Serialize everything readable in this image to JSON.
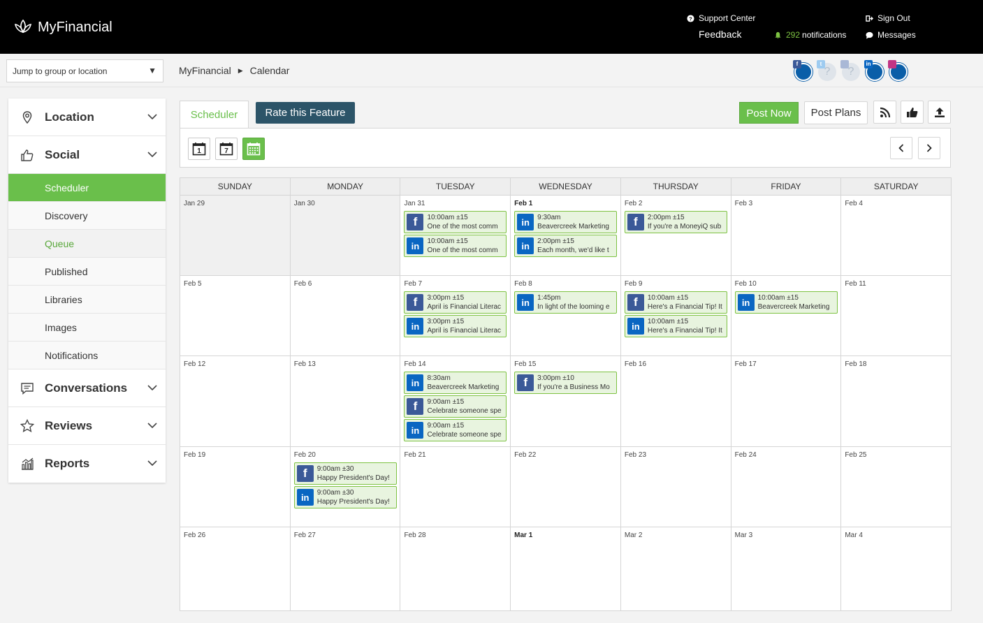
{
  "header": {
    "brand": "MyFinancial",
    "support": "Support Center",
    "feedback": "Feedback",
    "notif_count": "292",
    "notif_label": "notifications",
    "sign_out": "Sign Out",
    "messages": "Messages"
  },
  "subbar": {
    "jump_placeholder": "Jump to group or location",
    "crumb_root": "MyFinancial",
    "crumb_current": "Calendar"
  },
  "sidebar": {
    "location": "Location",
    "social": "Social",
    "social_items": [
      "Scheduler",
      "Discovery",
      "Queue",
      "Published",
      "Libraries",
      "Images",
      "Notifications"
    ],
    "conversations": "Conversations",
    "reviews": "Reviews",
    "reports": "Reports"
  },
  "main": {
    "tab_scheduler": "Scheduler",
    "rate_feature": "Rate this Feature",
    "post_now": "Post Now",
    "post_plans": "Post Plans",
    "day_view_num": "1",
    "week_view_num": "7"
  },
  "calendar": {
    "days": [
      "Sunday",
      "Monday",
      "Tuesday",
      "Wednesday",
      "Thursday",
      "Friday",
      "Saturday"
    ],
    "weeks": [
      [
        {
          "label": "Jan 29",
          "past": true,
          "posts": []
        },
        {
          "label": "Jan 30",
          "past": true,
          "posts": []
        },
        {
          "label": "Jan 31",
          "posts": [
            {
              "net": "facebook",
              "time": "10:00am ±15",
              "text": "One of the most comm"
            },
            {
              "net": "linkedin",
              "time": "10:00am ±15",
              "text": "One of the most comm"
            }
          ]
        },
        {
          "label": "Feb 1",
          "bold": true,
          "posts": [
            {
              "net": "linkedin",
              "time": "9:30am",
              "text": "Beavercreek Marketing"
            },
            {
              "net": "linkedin",
              "time": "2:00pm ±15",
              "text": "Each month, we'd like t"
            }
          ]
        },
        {
          "label": "Feb 2",
          "posts": [
            {
              "net": "facebook",
              "time": "2:00pm ±15",
              "text": "If you're a MoneyiQ sub"
            }
          ]
        },
        {
          "label": "Feb 3",
          "posts": []
        },
        {
          "label": "Feb 4",
          "posts": []
        }
      ],
      [
        {
          "label": "Feb 5",
          "posts": []
        },
        {
          "label": "Feb 6",
          "posts": []
        },
        {
          "label": "Feb 7",
          "posts": [
            {
              "net": "facebook",
              "time": "3:00pm ±15",
              "text": "April is Financial Literac"
            },
            {
              "net": "linkedin",
              "time": "3:00pm ±15",
              "text": "April is Financial Literac"
            }
          ]
        },
        {
          "label": "Feb 8",
          "posts": [
            {
              "net": "linkedin",
              "time": "1:45pm",
              "text": "In light of the looming e"
            }
          ]
        },
        {
          "label": "Feb 9",
          "posts": [
            {
              "net": "facebook",
              "time": "10:00am ±15",
              "text": "Here's a Financial Tip! It"
            },
            {
              "net": "linkedin",
              "time": "10:00am ±15",
              "text": "Here's a Financial Tip! It"
            }
          ]
        },
        {
          "label": "Feb 10",
          "posts": [
            {
              "net": "linkedin",
              "time": "10:00am ±15",
              "text": "Beavercreek Marketing"
            }
          ]
        },
        {
          "label": "Feb 11",
          "posts": []
        }
      ],
      [
        {
          "label": "Feb 12",
          "posts": []
        },
        {
          "label": "Feb 13",
          "posts": []
        },
        {
          "label": "Feb 14",
          "posts": [
            {
              "net": "linkedin",
              "time": "8:30am",
              "text": "Beavercreek Marketing"
            },
            {
              "net": "facebook",
              "time": "9:00am ±15",
              "text": "Celebrate someone spe"
            },
            {
              "net": "linkedin",
              "time": "9:00am ±15",
              "text": "Celebrate someone spe"
            }
          ]
        },
        {
          "label": "Feb 15",
          "posts": [
            {
              "net": "facebook",
              "time": "3:00pm ±10",
              "text": "If you're a Business Mo"
            }
          ]
        },
        {
          "label": "Feb 16",
          "posts": []
        },
        {
          "label": "Feb 17",
          "posts": []
        },
        {
          "label": "Feb 18",
          "posts": []
        }
      ],
      [
        {
          "label": "Feb 19",
          "posts": []
        },
        {
          "label": "Feb 20",
          "posts": [
            {
              "net": "facebook",
              "time": "9:00am ±30",
              "text": "Happy President's Day!"
            },
            {
              "net": "linkedin",
              "time": "9:00am ±30",
              "text": "Happy President's Day!"
            }
          ]
        },
        {
          "label": "Feb 21",
          "posts": []
        },
        {
          "label": "Feb 22",
          "posts": []
        },
        {
          "label": "Feb 23",
          "posts": []
        },
        {
          "label": "Feb 24",
          "posts": []
        },
        {
          "label": "Feb 25",
          "posts": []
        }
      ],
      [
        {
          "label": "Feb 26",
          "posts": []
        },
        {
          "label": "Feb 27",
          "posts": []
        },
        {
          "label": "Feb 28",
          "posts": []
        },
        {
          "label": "Mar 1",
          "bold": true,
          "posts": []
        },
        {
          "label": "Mar 2",
          "posts": []
        },
        {
          "label": "Mar 3",
          "posts": []
        },
        {
          "label": "Mar 4",
          "posts": []
        }
      ]
    ]
  },
  "colors": {
    "accent": "#6abf4b",
    "facebook": "#3b5998",
    "linkedin": "#0a66c2",
    "rate_button": "#2c5468"
  }
}
